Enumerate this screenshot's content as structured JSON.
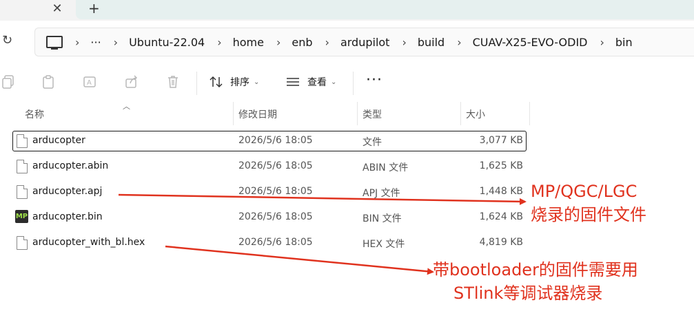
{
  "tabbar": {
    "close_glyph": "✕",
    "new_tab_glyph": "+"
  },
  "address": {
    "refresh_glyph": "↻",
    "more_glyph": "···",
    "crumbs": [
      "Ubuntu-22.04",
      "home",
      "enb",
      "ardupilot",
      "build",
      "CUAV-X25-EVO-ODID",
      "bin"
    ],
    "separator": "›"
  },
  "toolbar": {
    "sort_label": "排序",
    "view_label": "查看",
    "more_label": "···",
    "icons": [
      "copy-icon",
      "paste-icon",
      "rename-icon",
      "share-icon",
      "delete-icon"
    ]
  },
  "columns": {
    "name": "名称",
    "modified": "修改日期",
    "type": "类型",
    "size": "大小"
  },
  "files": [
    {
      "name": "arducopter",
      "modified": "2026/5/6 18:05",
      "type": "文件",
      "size": "3,077 KB",
      "icon": "file-icon",
      "selected": true
    },
    {
      "name": "arducopter.abin",
      "modified": "2026/5/6 18:05",
      "type": "ABIN 文件",
      "size": "1,625 KB",
      "icon": "file-icon"
    },
    {
      "name": "arducopter.apj",
      "modified": "2026/5/6 18:05",
      "type": "APJ 文件",
      "size": "1,448 KB",
      "icon": "file-icon"
    },
    {
      "name": "arducopter.bin",
      "modified": "2026/5/6 18:05",
      "type": "BIN 文件",
      "size": "1,624 KB",
      "icon": "missionplanner-icon"
    },
    {
      "name": "arducopter_with_bl.hex",
      "modified": "2026/5/6 18:05",
      "type": "HEX 文件",
      "size": "4,819 KB",
      "icon": "file-icon"
    }
  ],
  "annotations": {
    "apj_line1": "MP/QGC/LGC",
    "apj_line2": "烧录的固件文件",
    "hex_line1": "带bootloader的固件需要用",
    "hex_line2": "STlink等调试器烧录",
    "color": "#e0321e"
  },
  "mp_icon_text": "MP"
}
